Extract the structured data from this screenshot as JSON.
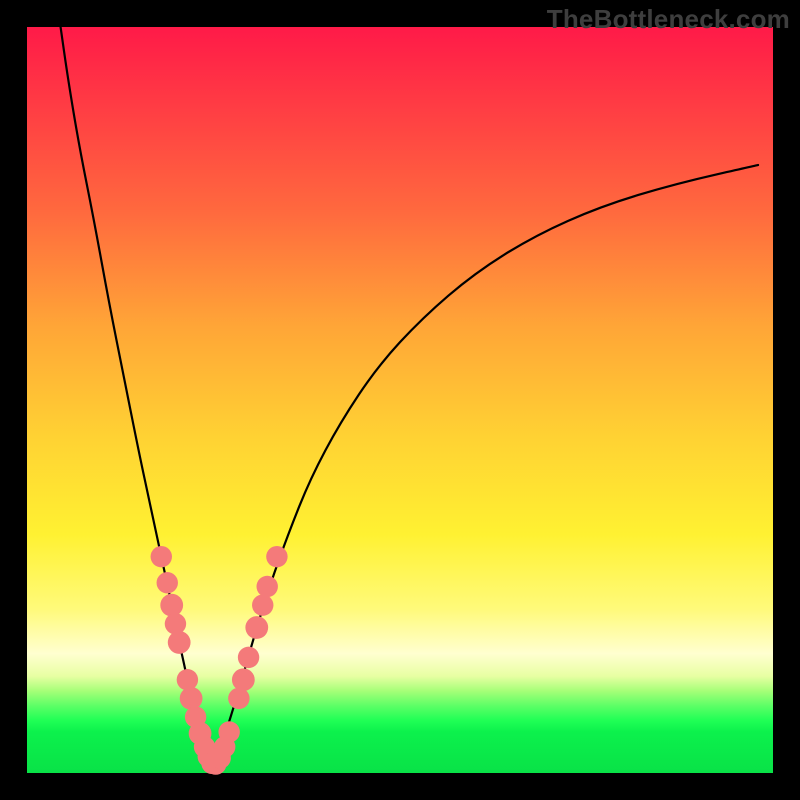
{
  "watermark": "TheBottleneck.com",
  "colors": {
    "frame": "#000000",
    "curve": "#000000",
    "dots": "#f47a7a",
    "gradient_top": "#ff1a48",
    "gradient_bottom": "#09e247"
  },
  "chart_data": {
    "type": "line",
    "title": "",
    "xlabel": "",
    "ylabel": "",
    "xlim": [
      0,
      100
    ],
    "ylim": [
      0,
      100
    ],
    "note": "Axes are unlabeled in the image; x and y are normalized 0–100 to the plot area. y=100 is top (red), y=0 is bottom (green).",
    "series": [
      {
        "name": "left-branch",
        "x": [
          4.5,
          5.5,
          7.0,
          9.0,
          11.0,
          13.0,
          15.0,
          16.5,
          18.0,
          19.3,
          20.3,
          21.3,
          22.0,
          22.8,
          23.6,
          24.3,
          25.0
        ],
        "y": [
          100.0,
          93.0,
          84.0,
          74.0,
          63.0,
          53.0,
          43.0,
          36.0,
          29.0,
          23.0,
          18.0,
          13.5,
          10.0,
          7.0,
          4.5,
          2.5,
          1.0
        ]
      },
      {
        "name": "right-branch",
        "x": [
          25.0,
          26.0,
          27.3,
          28.8,
          30.5,
          32.5,
          35.0,
          38.0,
          42.0,
          47.0,
          53.0,
          60.0,
          68.0,
          77.0,
          87.0,
          98.0
        ],
        "y": [
          1.0,
          3.5,
          7.5,
          12.5,
          18.5,
          25.0,
          32.0,
          39.5,
          47.0,
          54.5,
          61.0,
          67.0,
          72.0,
          76.0,
          79.0,
          81.5
        ]
      }
    ],
    "markers": [
      {
        "x": 18.0,
        "y": 29.0,
        "r": 1.0
      },
      {
        "x": 18.8,
        "y": 25.5,
        "r": 1.0
      },
      {
        "x": 19.4,
        "y": 22.5,
        "r": 1.1
      },
      {
        "x": 19.9,
        "y": 20.0,
        "r": 1.0
      },
      {
        "x": 20.4,
        "y": 17.5,
        "r": 1.1
      },
      {
        "x": 21.5,
        "y": 12.5,
        "r": 1.0
      },
      {
        "x": 22.0,
        "y": 10.0,
        "r": 1.1
      },
      {
        "x": 22.6,
        "y": 7.5,
        "r": 1.0
      },
      {
        "x": 23.2,
        "y": 5.3,
        "r": 1.1
      },
      {
        "x": 23.8,
        "y": 3.5,
        "r": 1.0
      },
      {
        "x": 24.3,
        "y": 2.2,
        "r": 1.0
      },
      {
        "x": 24.8,
        "y": 1.3,
        "r": 1.0
      },
      {
        "x": 25.3,
        "y": 1.2,
        "r": 1.0
      },
      {
        "x": 25.9,
        "y": 2.0,
        "r": 1.0
      },
      {
        "x": 26.5,
        "y": 3.5,
        "r": 1.0
      },
      {
        "x": 27.1,
        "y": 5.5,
        "r": 1.0
      },
      {
        "x": 28.4,
        "y": 10.0,
        "r": 1.0
      },
      {
        "x": 29.0,
        "y": 12.5,
        "r": 1.1
      },
      {
        "x": 29.7,
        "y": 15.5,
        "r": 1.0
      },
      {
        "x": 30.8,
        "y": 19.5,
        "r": 1.1
      },
      {
        "x": 31.6,
        "y": 22.5,
        "r": 1.0
      },
      {
        "x": 32.2,
        "y": 25.0,
        "r": 1.0
      },
      {
        "x": 33.5,
        "y": 29.0,
        "r": 1.0
      }
    ]
  }
}
